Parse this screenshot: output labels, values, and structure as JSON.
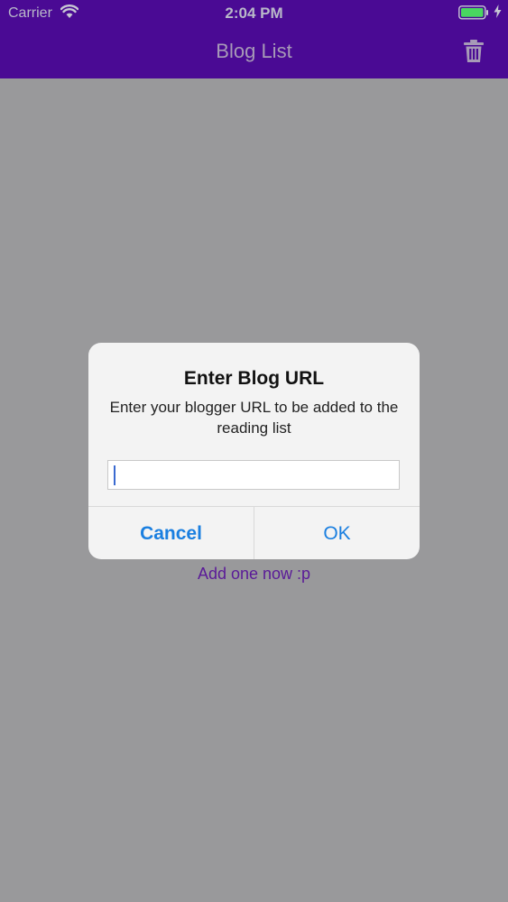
{
  "status_bar": {
    "carrier": "Carrier",
    "time": "2:04 PM",
    "wifi_icon": "wifi-icon",
    "battery_icon": "battery-icon",
    "charging_icon": "charging-bolt-icon"
  },
  "nav": {
    "title": "Blog List",
    "trash_icon": "trash-icon",
    "bar_color": "#4a0a94"
  },
  "background": {
    "add_link": "Add one now :p"
  },
  "alert": {
    "title": "Enter Blog URL",
    "message": "Enter your blogger URL to be added to the reading list",
    "input_value": "",
    "input_placeholder": "",
    "cancel_label": "Cancel",
    "ok_label": "OK",
    "button_color": "#1a7fe0"
  }
}
